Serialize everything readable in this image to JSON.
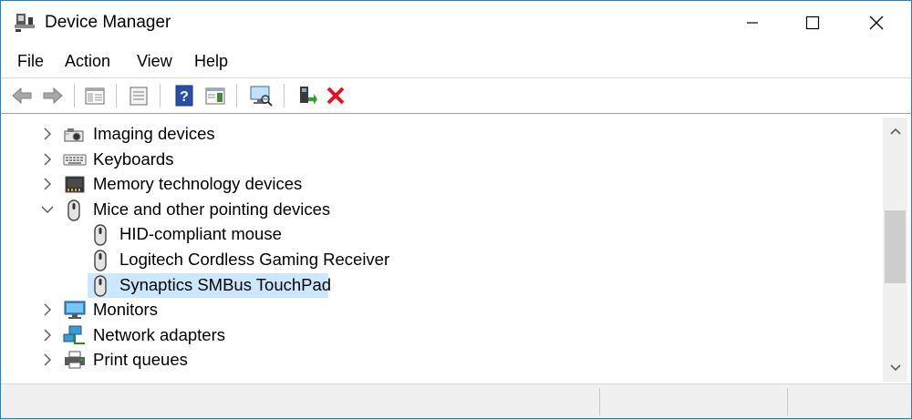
{
  "window": {
    "title": "Device Manager"
  },
  "menu": [
    {
      "label": "File"
    },
    {
      "label": "Action"
    },
    {
      "label": "View"
    },
    {
      "label": "Help"
    }
  ],
  "toolbar": {
    "buttons": [
      "back-icon",
      "forward-icon",
      "show-hide-console-tree-icon",
      "properties-icon",
      "help-icon",
      "action-pane-icon",
      "scan-hardware-icon",
      "update-driver-icon",
      "uninstall-icon"
    ]
  },
  "tree": {
    "items": [
      {
        "label": "Imaging devices",
        "level": 0,
        "expanded": false,
        "icon": "camera-icon"
      },
      {
        "label": "Keyboards",
        "level": 0,
        "expanded": false,
        "icon": "keyboard-icon"
      },
      {
        "label": "Memory technology devices",
        "level": 0,
        "expanded": false,
        "icon": "memory-card-icon"
      },
      {
        "label": "Mice and other pointing devices",
        "level": 0,
        "expanded": true,
        "icon": "mouse-icon"
      },
      {
        "label": "HID-compliant mouse",
        "level": 1,
        "icon": "mouse-icon"
      },
      {
        "label": "Logitech Cordless Gaming Receiver",
        "level": 1,
        "icon": "mouse-icon"
      },
      {
        "label": "Synaptics SMBus TouchPad",
        "level": 1,
        "icon": "mouse-icon",
        "selected": true
      },
      {
        "label": "Monitors",
        "level": 0,
        "expanded": false,
        "icon": "monitor-icon"
      },
      {
        "label": "Network adapters",
        "level": 0,
        "expanded": false,
        "icon": "network-icon"
      },
      {
        "label": "Print queues",
        "level": 0,
        "expanded": false,
        "icon": "printer-icon"
      }
    ]
  },
  "colors": {
    "selection": "#cce8ff",
    "accent": "#1883d7",
    "uninstall": "#e81123"
  }
}
